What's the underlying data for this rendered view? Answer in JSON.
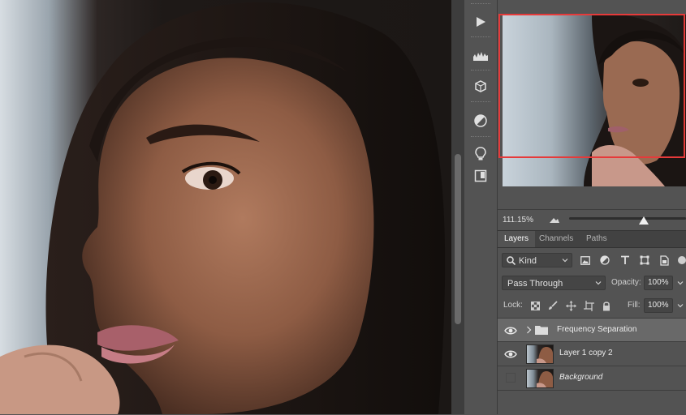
{
  "navigator": {
    "zoom": "111.15%",
    "zoom_slider_position": 0.64
  },
  "layers_panel": {
    "tabs": [
      "Layers",
      "Channels",
      "Paths"
    ],
    "active_tab": "Layers",
    "filter": {
      "kind_label": "Kind"
    },
    "blend_mode": "Pass Through",
    "opacity_label": "Opacity:",
    "opacity_value": "100%",
    "lock_label": "Lock:",
    "fill_label": "Fill:",
    "fill_value": "100%",
    "layers": [
      {
        "name": "Frequency Separation",
        "type": "group",
        "visible": true,
        "selected": true
      },
      {
        "name": "Layer 1 copy 2",
        "type": "pixel",
        "visible": true,
        "selected": false
      },
      {
        "name": "Background",
        "type": "pixel",
        "visible": false,
        "selected": false,
        "italic": true
      }
    ]
  },
  "colors": {
    "panel_bg": "#535353",
    "selected_row": "#696969",
    "navigator_view_box": "#e63a3a"
  },
  "icons": {
    "tool_strip": [
      "play-icon",
      "histogram-icon",
      "properties-cube-icon",
      "adjustments-icon",
      "light-bulb-icon",
      "libraries-icon"
    ],
    "layer_filters": [
      "image-filter-icon",
      "adjustment-filter-icon",
      "type-filter-icon",
      "shape-filter-icon",
      "smart-object-filter-icon"
    ],
    "locks": [
      "lock-transparent-icon",
      "lock-brush-icon",
      "lock-position-icon",
      "lock-artboard-icon",
      "lock-all-icon"
    ]
  }
}
